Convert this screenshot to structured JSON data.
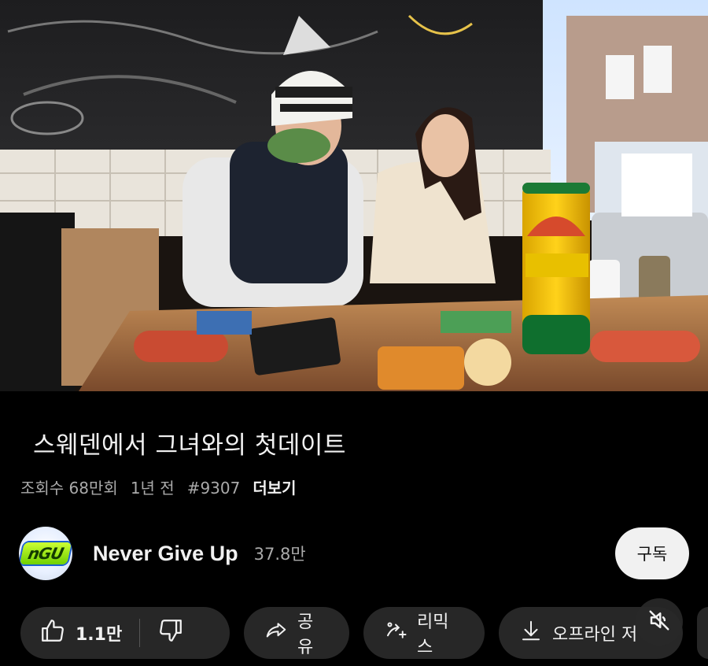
{
  "video": {
    "title": "스웨덴에서 그녀와의 첫데이트",
    "views": "조회수 68만회",
    "age": "1년 전",
    "hashtag": "#9307",
    "more_label": "더보기"
  },
  "channel": {
    "name": "Never Give Up",
    "subscribers": "37.8만",
    "avatar_text": "nGU",
    "subscribe_label": "구독"
  },
  "actions": {
    "like_count": "1.1만",
    "share_label": "공유",
    "remix_label": "리믹스",
    "offline_label": "오프라인 저"
  },
  "colors": {
    "background": "#000000",
    "pill": "#272727",
    "subscribe_bg": "#f1f1f1",
    "secondary_text": "#aaaaaa"
  },
  "icons": {
    "like": "thumbs-up-icon",
    "dislike": "thumbs-down-icon",
    "share": "share-arrow-icon",
    "remix": "remix-icon",
    "download": "download-icon",
    "mute": "muted-speaker-icon"
  }
}
